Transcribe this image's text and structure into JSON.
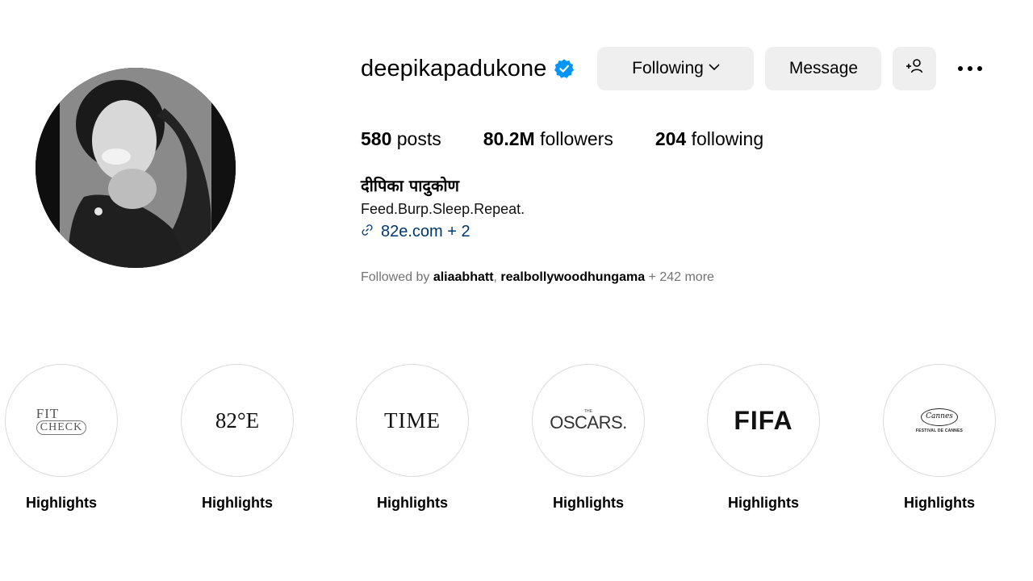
{
  "profile": {
    "username": "deepikapadukone",
    "verified": true,
    "full_name": "दीपिका पादुकोण",
    "bio": "Feed.Burp.Sleep.Repeat.",
    "link_text": "82e.com + 2",
    "avatar_icon": "profile-photo"
  },
  "actions": {
    "following_label": "Following",
    "message_label": "Message",
    "add_icon": "person-add-icon",
    "more_icon": "more-options-icon"
  },
  "stats": {
    "posts_value": "580",
    "posts_label": "posts",
    "followers_value": "80.2M",
    "followers_label": "followers",
    "following_value": "204",
    "following_label": "following"
  },
  "followed_by": {
    "prefix": "Followed by ",
    "user1": "aliaabhatt",
    "separator": ", ",
    "user2": "realbollywoodhungama",
    "suffix": " + 242 more"
  },
  "highlights": [
    {
      "label": "Highlights",
      "logo_text": "FIT CHECK",
      "logo_top": "FIT",
      "logo_bottom": "CHECK"
    },
    {
      "label": "Highlights",
      "logo_text": "82°E"
    },
    {
      "label": "Highlights",
      "logo_text": "TIME"
    },
    {
      "label": "Highlights",
      "logo_text": "OSCARS.",
      "logo_small": "THE"
    },
    {
      "label": "Highlights",
      "logo_text": "FIFA"
    },
    {
      "label": "Highlights",
      "logo_text": "FESTIVAL DE CANNES",
      "logo_script": "Cannes"
    }
  ],
  "colors": {
    "verified_blue": "#0095f6",
    "button_bg": "#efefef",
    "link_color": "#00376b",
    "muted_text": "#737373"
  }
}
